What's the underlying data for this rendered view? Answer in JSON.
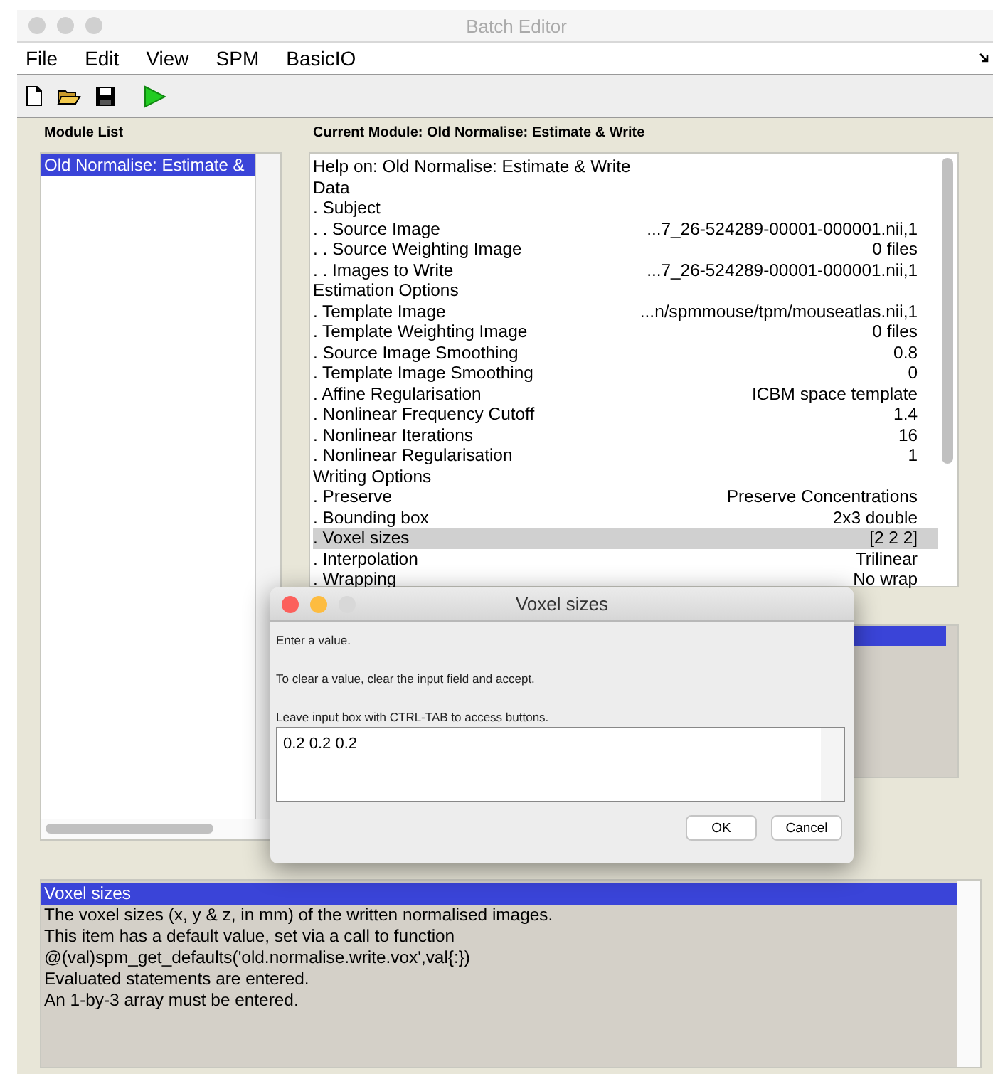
{
  "window": {
    "title": "Batch Editor"
  },
  "menu": [
    "File",
    "Edit",
    "View",
    "SPM",
    "BasicIO"
  ],
  "module_list": {
    "heading": "Module List",
    "items": [
      {
        "label": "Old Normalise: Estimate &",
        "selected": true
      }
    ]
  },
  "current_module": {
    "heading": "Current Module: Old Normalise: Estimate & Write",
    "rows": [
      {
        "label": "Help on: Old Normalise: Estimate & Write",
        "selected": false
      },
      {
        "label": "Data",
        "selected": false
      },
      {
        "label": ". Subject",
        "selected": false
      },
      {
        "label": ". . Source Image",
        "value": "...7_26-524289-00001-000001.nii,1",
        "selected": false
      },
      {
        "label": ". . Source Weighting Image",
        "value": "0 files",
        "selected": false
      },
      {
        "label": ". . Images to Write",
        "value": "...7_26-524289-00001-000001.nii,1",
        "selected": false
      },
      {
        "label": "Estimation Options",
        "selected": false
      },
      {
        "label": ". Template Image",
        "value": "...n/spmmouse/tpm/mouseatlas.nii,1",
        "selected": false
      },
      {
        "label": ". Template Weighting Image",
        "value": "0 files",
        "selected": false
      },
      {
        "label": ". Source Image Smoothing",
        "value": "0.8",
        "selected": false
      },
      {
        "label": ". Template Image Smoothing",
        "value": "0",
        "selected": false
      },
      {
        "label": ". Affine Regularisation",
        "value": "ICBM space template",
        "selected": false
      },
      {
        "label": ". Nonlinear Frequency Cutoff",
        "value": "1.4",
        "selected": false
      },
      {
        "label": ". Nonlinear Iterations",
        "value": "16",
        "selected": false
      },
      {
        "label": ". Nonlinear Regularisation",
        "value": "1",
        "selected": false
      },
      {
        "label": "Writing Options",
        "selected": false
      },
      {
        "label": ". Preserve",
        "value": "Preserve Concentrations",
        "selected": false
      },
      {
        "label": ". Bounding box",
        "value": "2x3 double",
        "selected": false
      },
      {
        "label": ". Voxel sizes",
        "value": "[2 2 2]",
        "selected": true
      },
      {
        "label": ". Interpolation",
        "value": "Trilinear",
        "selected": false
      },
      {
        "label": ". Wrapping",
        "value": "No wrap",
        "selected": false
      }
    ]
  },
  "help": {
    "lines": [
      {
        "text": "Voxel sizes",
        "selected": true
      },
      {
        "text": "The voxel sizes (x, y & z, in mm) of the written normalised images.",
        "selected": false
      },
      {
        "text": "This item has a default value, set via a call to function",
        "selected": false
      },
      {
        "text": "@(val)spm_get_defaults('old.normalise.write.vox',val{:})",
        "selected": false
      },
      {
        "text": "Evaluated statements are entered.",
        "selected": false
      },
      {
        "text": "An 1-by-3 array must be entered.",
        "selected": false
      }
    ]
  },
  "dialog": {
    "title": "Voxel sizes",
    "messages": [
      "Enter a value.",
      "To clear a value, clear the input field and accept.",
      "Leave input box with CTRL-TAB to access buttons."
    ],
    "value": "0.2 0.2 0.2",
    "buttons": [
      "OK",
      "Cancel"
    ]
  }
}
